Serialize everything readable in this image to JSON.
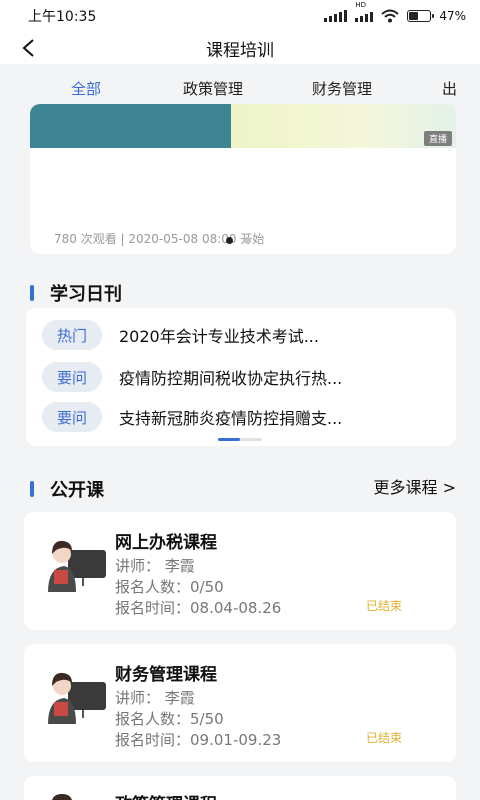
{
  "status_bar": {
    "time": "上午10:35",
    "network": "HD",
    "battery": "47",
    "battery_fraction": 0.47
  },
  "nav": {
    "title": "课程培训"
  },
  "tabs": [
    {
      "label": "全部",
      "active": true
    },
    {
      "label": "政策管理",
      "active": false
    },
    {
      "label": "财务管理",
      "active": false
    },
    {
      "label": "出",
      "active": false
    }
  ],
  "banner": {
    "live_label": "直播",
    "meta": "780 次观看 | 2020-05-08 08:00 开始"
  },
  "daily": {
    "title": "学习日刊",
    "items": [
      {
        "tag": "热门",
        "text": "2020年会计专业技术考试..."
      },
      {
        "tag": "要问",
        "text": "疫情防控期间税收协定执行热..."
      },
      {
        "tag": "要问",
        "text": "支持新冠肺炎疫情防控捐赠支..."
      }
    ]
  },
  "public": {
    "title": "公开课",
    "more": "更多课程 >",
    "courses": [
      {
        "name": "网上办税课程",
        "teacher": "讲师：  李霞",
        "enroll": "报名人数：0/50",
        "time": "报名时间：08.04-08.26",
        "status": "已结束"
      },
      {
        "name": "财务管理课程",
        "teacher": "讲师：  李霞",
        "enroll": "报名人数：5/50",
        "time": "报名时间：09.01-09.23",
        "status": "已结束"
      },
      {
        "name": "政策管理课程"
      }
    ]
  },
  "colors": {
    "accent": "#3a6ed3",
    "status_ended": "#e0b030",
    "banner_teal": "#3e8494"
  }
}
